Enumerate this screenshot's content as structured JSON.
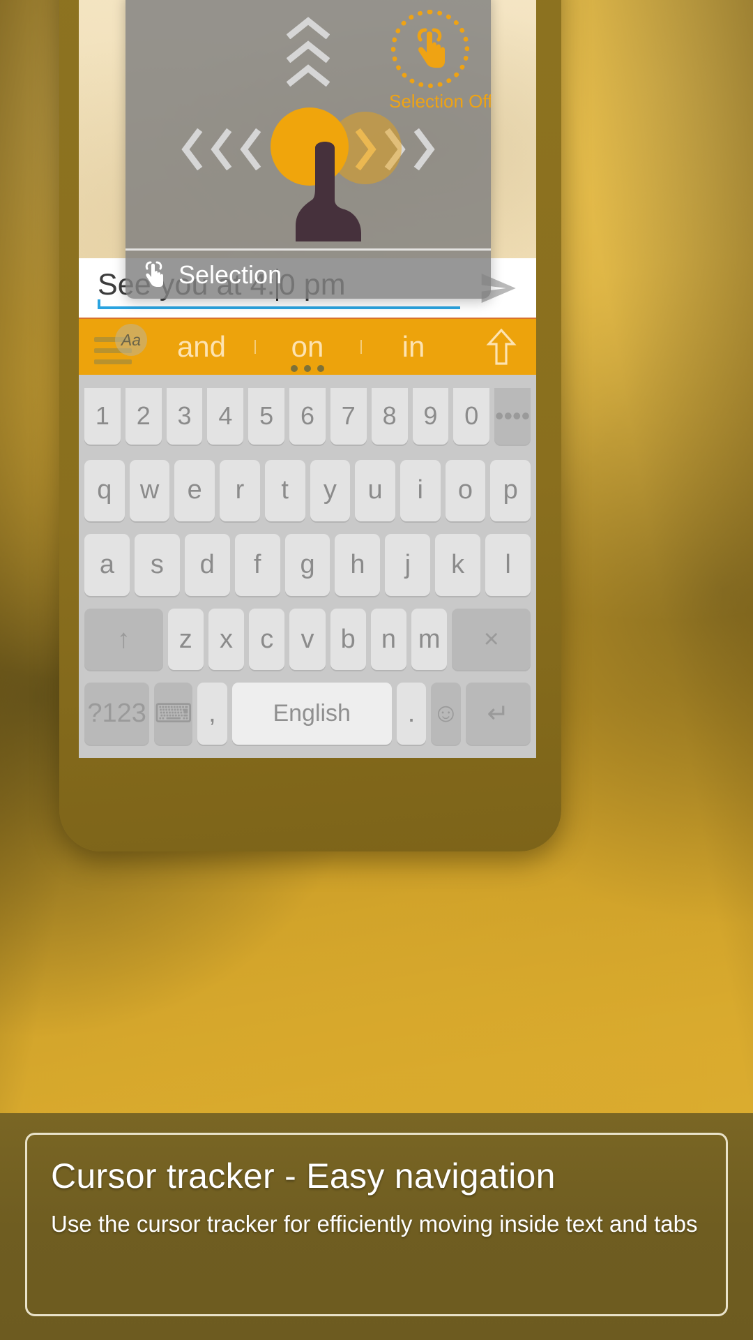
{
  "message_input": {
    "text_before_caret": "See you at 4:",
    "text_after_caret": "0 pm",
    "send_icon": "send-paper-plane-icon"
  },
  "suggestion_bar": {
    "menu_icon": "hamburger-menu-icon",
    "menu_badge": "Aa",
    "suggestions": [
      {
        "label": "and"
      },
      {
        "label": "on"
      },
      {
        "label": "in"
      }
    ],
    "shift_icon": "arrow-up-expand-icon",
    "accent_color": "#eda30c"
  },
  "cursor_tracker": {
    "selection_toggle_label": "Selection Off",
    "selection_toggle_icon": "tap-finger-icon",
    "footer_label": "Selection",
    "footer_icon": "tap-finger-icon",
    "up_chevron_icon": "chevron-up-icon",
    "left_chevron_icon": "chevron-left-icon",
    "right_chevron_icon": "chevron-right-icon",
    "thumb_icon": "thumb-finger-icon",
    "accent_color": "#f0a50c"
  },
  "keyboard": {
    "number_row": [
      "1",
      "2",
      "3",
      "4",
      "5",
      "6",
      "7",
      "8",
      "9",
      "0",
      "••••"
    ],
    "row_q": [
      "q",
      "w",
      "e",
      "r",
      "t",
      "y",
      "u",
      "i",
      "o",
      "p"
    ],
    "row_a": [
      "a",
      "s",
      "d",
      "f",
      "g",
      "h",
      "j",
      "k",
      "l"
    ],
    "row_z": [
      "↑",
      "z",
      "x",
      "c",
      "v",
      "b",
      "n",
      "m",
      "×"
    ],
    "bottom_row": [
      "?123",
      "⌨",
      ",",
      "English",
      ".",
      "☺",
      "↵"
    ],
    "space_label": "English"
  },
  "caption": {
    "title": "Cursor tracker -  Easy navigation",
    "subtitle": "Use the cursor tracker for efficiently moving inside text and tabs"
  }
}
